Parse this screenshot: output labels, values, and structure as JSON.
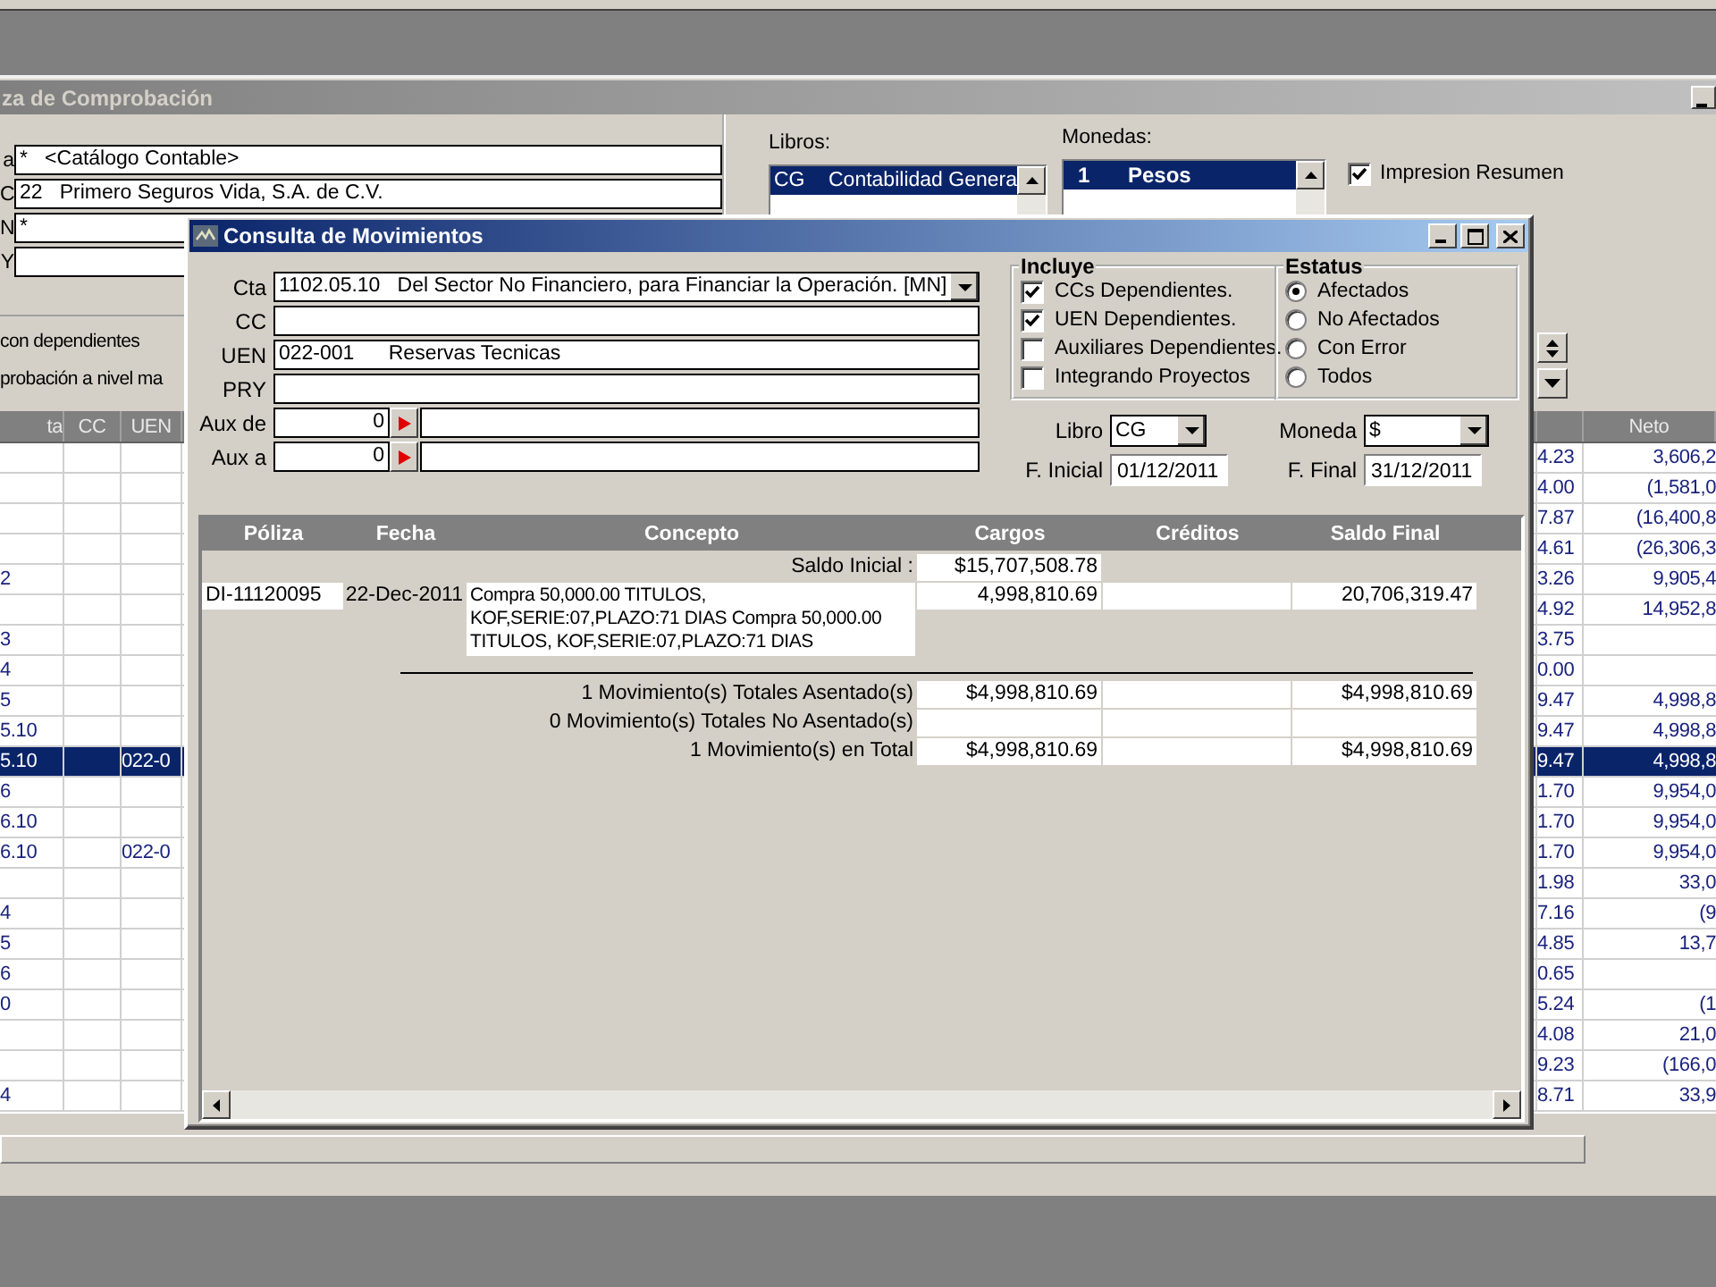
{
  "background_window": {
    "title": "za de Comprobación",
    "fields": [
      {
        "label": "a",
        "value": "*   <Catálogo Contable>"
      },
      {
        "label": "C",
        "value": "22   Primero Seguros Vida, S.A. de C.V."
      },
      {
        "label": "N",
        "value": "*"
      },
      {
        "label": "Y"
      }
    ],
    "options": [
      "con dependientes",
      "probación a nivel ma"
    ],
    "libros": {
      "label": "Libros:",
      "items": [
        {
          "code": "CG",
          "name": "Contabilidad Genera",
          "selected": true
        }
      ]
    },
    "monedas": {
      "label": "Monedas:",
      "items": [
        {
          "code": "1",
          "name": "Pesos",
          "selected": true
        }
      ]
    },
    "impresion_resumen": {
      "label": "Impresion Resumen",
      "checked": true
    },
    "grid": {
      "columns": [
        "ta",
        "CC",
        "UEN",
        "Neto"
      ],
      "rows": [
        {
          "column_4": "4.23",
          "neto": "3,606,2",
          "selected": false
        },
        {
          "column_4": "4.00",
          "neto": "(1,581,0",
          "selected": false
        },
        {
          "column_4": "7.87",
          "neto": "(16,400,8",
          "selected": false
        },
        {
          "column_4": "4.61",
          "neto": "(26,306,3",
          "selected": false
        },
        {
          "column_1": "2",
          "column_4": "3.26",
          "neto": "9,905,4",
          "selected": false
        },
        {
          "column_4": "4.92",
          "neto": "14,952,8",
          "selected": false
        },
        {
          "column_1": "3",
          "column_4": "3.75",
          "selected": false
        },
        {
          "column_1": "4",
          "column_4": "0.00",
          "selected": false
        },
        {
          "column_1": "5",
          "column_4": "9.47",
          "neto": "4,998,8",
          "selected": false
        },
        {
          "column_1": "5.10",
          "column_4": "9.47",
          "neto": "4,998,8",
          "selected": false
        },
        {
          "column_1": "5.10",
          "uen": "022-0",
          "column_4": "9.47",
          "neto": "4,998,8",
          "selected": true
        },
        {
          "column_1": "6",
          "column_4": "1.70",
          "neto": "9,954,0",
          "selected": false
        },
        {
          "column_1": "6.10",
          "column_4": "1.70",
          "neto": "9,954,0",
          "selected": false
        },
        {
          "column_1": "6.10",
          "uen": "022-0",
          "column_4": "1.70",
          "neto": "9,954,0",
          "selected": false
        },
        {
          "column_4": "1.98",
          "neto": "33,0",
          "selected": false
        },
        {
          "column_1": "4",
          "column_4": "7.16",
          "neto": "(9",
          "selected": false
        },
        {
          "column_1": "5",
          "column_4": "4.85",
          "neto": "13,7",
          "selected": false
        },
        {
          "column_1": "6",
          "column_4": "0.65",
          "selected": false
        },
        {
          "column_1": "0",
          "column_4": "5.24",
          "neto": "(1",
          "selected": false
        },
        {
          "column_4": "4.08",
          "neto": "21,0",
          "selected": false
        },
        {
          "column_4": "9.23",
          "neto": "(166,0",
          "selected": false
        },
        {
          "column_1": "4",
          "column_4": "8.71",
          "neto": "33,9",
          "selected": false
        }
      ]
    }
  },
  "dialog": {
    "title": "Consulta de Movimientos",
    "fields": [
      {
        "label": "Cta",
        "value": "1102.05.10   Del Sector No Financiero, para Financiar la Operación. [MN]",
        "kind": "combo"
      },
      {
        "label": "CC",
        "kind": "text"
      },
      {
        "label": "UEN",
        "value": "022-001      Reservas Tecnicas",
        "kind": "text"
      },
      {
        "label": "PRY",
        "kind": "text"
      },
      {
        "label": "Aux de",
        "value": "0",
        "kind": "aux"
      },
      {
        "label": "Aux a",
        "value": "0",
        "kind": "aux"
      }
    ],
    "incluye": {
      "title": "Incluye",
      "options": [
        {
          "label": "CCs Dependientes.",
          "checked": true
        },
        {
          "label": "UEN Dependientes.",
          "checked": true
        },
        {
          "label": "Auxiliares Dependientes.",
          "checked": false
        },
        {
          "label": "Integrando Proyectos",
          "checked": false
        }
      ]
    },
    "estatus": {
      "title": "Estatus",
      "options": [
        {
          "label": "Afectados",
          "selected": true
        },
        {
          "label": "No Afectados",
          "selected": false
        },
        {
          "label": "Con Error",
          "selected": false
        },
        {
          "label": "Todos",
          "selected": false
        }
      ]
    },
    "libro": {
      "label": "Libro",
      "value": "CG"
    },
    "moneda": {
      "label": "Moneda",
      "value": "$"
    },
    "fecha_inicial": {
      "label": "F. Inicial",
      "value": "01/12/2011"
    },
    "fecha_final": {
      "label": "F. Final",
      "value": "31/12/2011"
    },
    "table": {
      "columns": [
        "Póliza",
        "Fecha",
        "Concepto",
        "Cargos",
        "Créditos",
        "Saldo Final"
      ],
      "saldo_inicial": {
        "label": "Saldo Inicial :",
        "cargos": "$15,707,508.78"
      },
      "rows": [
        {
          "poliza": "DI-11120095",
          "fecha": "22-Dec-2011",
          "concepto": "Compra 50,000.00 TITULOS, KOF,SERIE:07,PLAZO:71 DIAS Compra 50,000.00 TITULOS, KOF,SERIE:07,PLAZO:71 DIAS",
          "cargos": "4,998,810.69",
          "saldo_final": "20,706,319.47"
        }
      ],
      "totals": [
        {
          "label": "1 Movimiento(s) Totales Asentado(s)",
          "cargos": "$4,998,810.69",
          "saldo_final": "$4,998,810.69"
        },
        {
          "label": "0 Movimiento(s) Totales No Asentado(s)"
        },
        {
          "label": "1 Movimiento(s) en Total",
          "cargos": "$4,998,810.69",
          "saldo_final": "$4,998,810.69"
        }
      ]
    }
  }
}
